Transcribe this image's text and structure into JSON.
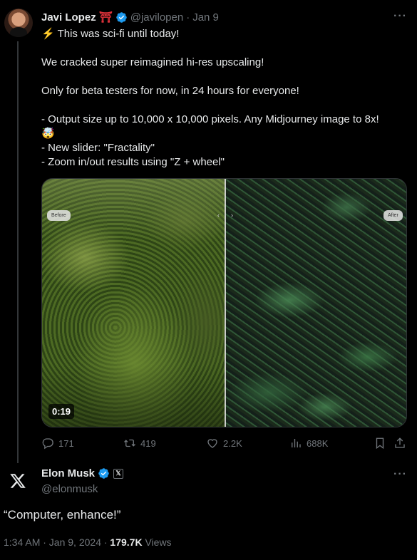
{
  "tweet": {
    "author_name": "Javi Lopez",
    "author_emoji": "⛩",
    "handle": "@javilopen",
    "separator": "·",
    "date": "Jan 9",
    "more": "···",
    "lines": [
      "⚡ This was sci-fi until today!",
      "We cracked super reimagined hi-res upscaling!",
      "Only for beta testers for now, in 24 hours for everyone!",
      "- Output size up to 10,000 x 10,000 pixels. Any Midjourney image to 8x!",
      "🤯",
      "- New slider: \"Fractality\"",
      "- Zoom in/out results using \"Z + wheel\""
    ],
    "media": {
      "before_label": "Before",
      "after_label": "After",
      "duration": "0:19",
      "split_fraction": 0.5
    },
    "actions": {
      "replies": "171",
      "reposts": "419",
      "likes": "2.2K",
      "views": "688K"
    }
  },
  "reply": {
    "author_name": "Elon Musk",
    "badge": "𝕏",
    "handle": "@elonmusk",
    "more": "···",
    "text": "“Computer, enhance!”",
    "time": "1:34 AM · Jan 9, 2024 ·",
    "views_count": "179.7K",
    "views_label": "Views"
  },
  "colors": {
    "background": "#000000",
    "text": "#e7e9ea",
    "muted": "#71767b",
    "verified": "#1d9bf0"
  }
}
